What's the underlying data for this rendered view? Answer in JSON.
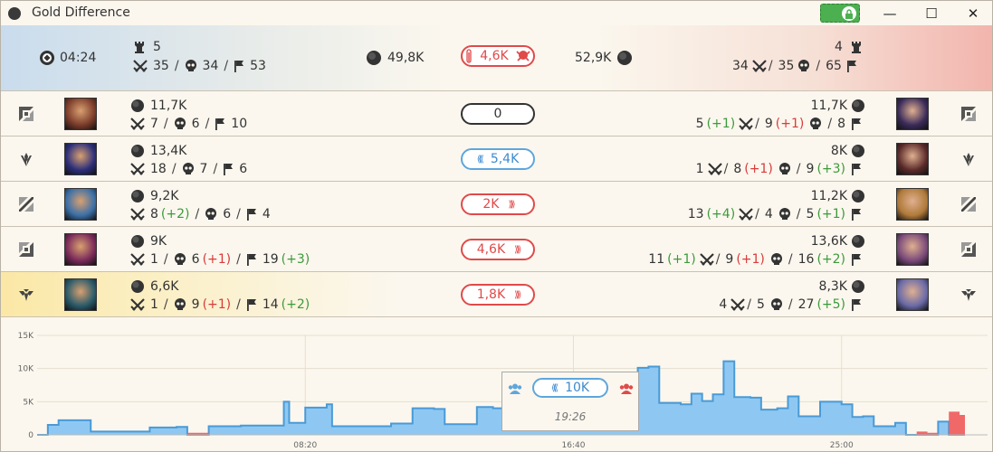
{
  "window": {
    "title": "Gold Difference",
    "minimize": "—",
    "maximize": "☐",
    "close": "✕"
  },
  "summary": {
    "time": "04:24",
    "blue": {
      "towers": "5",
      "kills": "35",
      "deaths": "34",
      "assists": "53",
      "gold": "49,8K"
    },
    "red": {
      "towers": "4",
      "kills": "34",
      "deaths": "35",
      "assists": "65",
      "gold": "52,9K"
    },
    "diff": "4,6K",
    "sep": "/"
  },
  "rows": [
    {
      "lane": "top",
      "highlight": false,
      "blue": {
        "gold": "11,7K",
        "k": "7",
        "kd": "",
        "d": "6",
        "dd": "",
        "a": "10",
        "ad": ""
      },
      "diff": {
        "value": "0",
        "side": "neutral"
      },
      "red": {
        "gold": "11,7K",
        "k": "5",
        "kd": "(+1)",
        "d": "9",
        "dd": "(+1)",
        "a": "8",
        "ad": ""
      },
      "blue_color": "#7a3b2a",
      "red_color": "#3a2b5a"
    },
    {
      "lane": "jungle",
      "highlight": false,
      "blue": {
        "gold": "13,4K",
        "k": "18",
        "kd": "",
        "d": "7",
        "dd": "",
        "a": "6",
        "ad": ""
      },
      "diff": {
        "value": "5,4K",
        "side": "blue"
      },
      "red": {
        "gold": "8K",
        "k": "1",
        "kd": "",
        "d": "8",
        "dd": "(+1)",
        "a": "9",
        "ad": "(+3)"
      },
      "blue_color": "#2b2e7a",
      "red_color": "#5a2a2a"
    },
    {
      "lane": "mid",
      "highlight": false,
      "blue": {
        "gold": "9,2K",
        "k": "8",
        "kd": "(+2)",
        "d": "6",
        "dd": "",
        "a": "4",
        "ad": ""
      },
      "diff": {
        "value": "2K",
        "side": "red"
      },
      "red": {
        "gold": "11,2K",
        "k": "13",
        "kd": "(+4)",
        "d": "4",
        "dd": "",
        "a": "5",
        "ad": "(+1)"
      },
      "blue_color": "#3a6fa8",
      "red_color": "#b07a3a"
    },
    {
      "lane": "bot",
      "highlight": false,
      "blue": {
        "gold": "9K",
        "k": "1",
        "kd": "",
        "d": "6",
        "dd": "(+1)",
        "a": "19",
        "ad": "(+3)"
      },
      "diff": {
        "value": "4,6K",
        "side": "red"
      },
      "red": {
        "gold": "13,6K",
        "k": "11",
        "kd": "(+1)",
        "d": "9",
        "dd": "(+1)",
        "a": "16",
        "ad": "(+2)"
      },
      "blue_color": "#7a2a5a",
      "red_color": "#7a4a7a"
    },
    {
      "lane": "support",
      "highlight": true,
      "blue": {
        "gold": "6,6K",
        "k": "1",
        "kd": "",
        "d": "9",
        "dd": "(+1)",
        "a": "14",
        "ad": "(+2)"
      },
      "diff": {
        "value": "1,8K",
        "side": "red"
      },
      "red": {
        "gold": "8,3K",
        "k": "4",
        "kd": "",
        "d": "5",
        "dd": "",
        "a": "27",
        "ad": "(+5)"
      },
      "blue_color": "#2a5a6a",
      "red_color": "#6a6aa8"
    }
  ],
  "chart_data": {
    "type": "area",
    "ylim": [
      0,
      15000
    ],
    "yticks": [
      "15K",
      "10K",
      "5K",
      "0"
    ],
    "xticks": [
      "08:20",
      "16:40",
      "25:00"
    ],
    "xlim": [
      0,
      1730
    ],
    "series": [
      {
        "color_pos": "#8ec8f2",
        "line_pos": "#4a9ad6",
        "color_neg": "#f06060",
        "t": [
          0,
          20,
          40,
          80,
          100,
          150,
          210,
          260,
          280,
          320,
          380,
          440,
          460,
          470,
          490,
          500,
          540,
          550,
          620,
          660,
          700,
          740,
          760,
          800,
          820,
          850,
          870,
          900,
          920,
          940,
          960,
          990,
          1000,
          1040,
          1060,
          1100,
          1120,
          1140,
          1160,
          1200,
          1220,
          1240,
          1260,
          1280,
          1300,
          1330,
          1350,
          1380,
          1400,
          1420,
          1460,
          1500,
          1520,
          1540,
          1560,
          1600,
          1620,
          1640,
          1660,
          1680,
          1700,
          1720,
          1730
        ],
        "v": [
          0,
          1500,
          2200,
          2200,
          500,
          500,
          1100,
          1200,
          -300,
          1300,
          1400,
          1400,
          5000,
          1800,
          1800,
          4100,
          4600,
          1300,
          1300,
          1700,
          4000,
          3900,
          1600,
          1600,
          4200,
          4000,
          1200,
          1200,
          6700,
          7100,
          6500,
          6200,
          3400,
          4100,
          3500,
          7400,
          10100,
          10300,
          4800,
          4600,
          6200,
          5100,
          6100,
          11100,
          5700,
          5600,
          3800,
          4000,
          5800,
          2800,
          5000,
          4600,
          2700,
          2800,
          1300,
          1800,
          0,
          -500,
          -300,
          2000,
          -3500,
          -3000,
          0
        ]
      }
    ],
    "tooltip": {
      "value": "10K",
      "time": "19:26"
    }
  },
  "colors": {
    "blue": "#3d8bd0",
    "red": "#e04a4a",
    "green": "#3c9a3c"
  }
}
